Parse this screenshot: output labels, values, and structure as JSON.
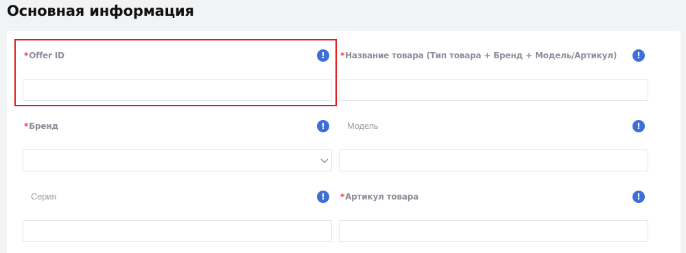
{
  "section": {
    "title": "Основная информация"
  },
  "required_mark": "*",
  "info_icon_glyph": "!",
  "fields": {
    "offer_id": {
      "label": "Offer ID",
      "value": "",
      "required": true
    },
    "product_name": {
      "label": "Название товара (Тип товара + Бренд + Модель/Артикул)",
      "value": "",
      "required": true
    },
    "brand": {
      "label": "Бренд",
      "value": "",
      "required": true
    },
    "model": {
      "label": "Модель",
      "value": "",
      "required": false
    },
    "series": {
      "label": "Серия",
      "value": "",
      "required": false
    },
    "article": {
      "label": "Артикул товара",
      "value": "",
      "required": true
    }
  },
  "colors": {
    "required": "#e84040",
    "info_icon": "#3f6fd6",
    "highlight_border": "#e01b1b"
  }
}
